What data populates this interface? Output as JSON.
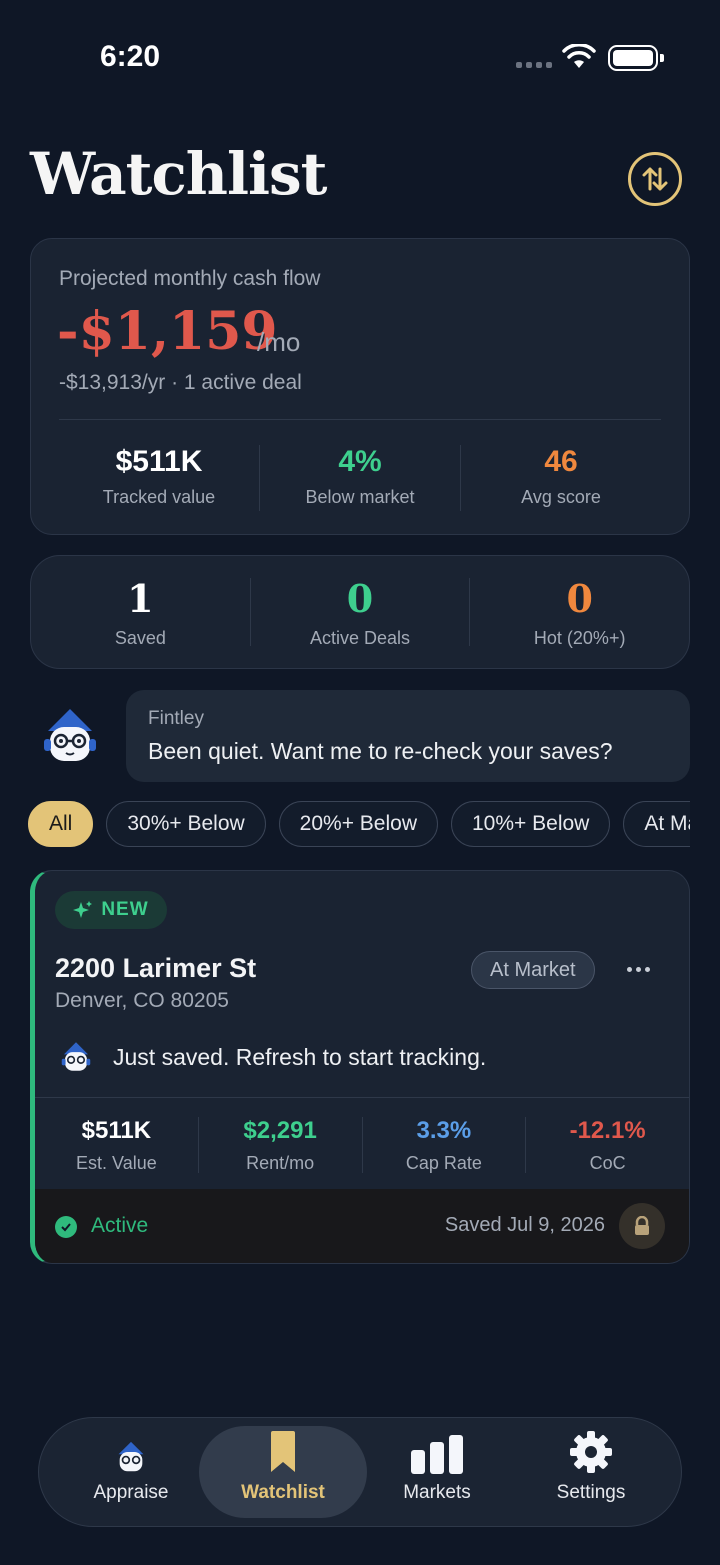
{
  "status_bar": {
    "time": "6:20"
  },
  "header": {
    "title": "Watchlist",
    "sort_icon": "sort-arrows-icon"
  },
  "cash_flow": {
    "label": "Projected monthly cash flow",
    "value": "-$1,159",
    "unit": "/mo",
    "sub": "-$13,913/yr · 1 active deal",
    "stats": [
      {
        "value": "$511K",
        "label": "Tracked value",
        "color": "#ffffff"
      },
      {
        "value": "4%",
        "label": "Below market",
        "color": "#3ecf8e"
      },
      {
        "value": "46",
        "label": "Avg score",
        "color": "#f0883e"
      }
    ]
  },
  "counts": [
    {
      "value": "1",
      "label": "Saved",
      "color": "#ffffff"
    },
    {
      "value": "0",
      "label": "Active Deals",
      "color": "#3ecf8e"
    },
    {
      "value": "0",
      "label": "Hot (20%+)",
      "color": "#f0883e"
    }
  ],
  "assistant": {
    "name": "Fintley",
    "message": "Been quiet. Want me to re-check your saves?"
  },
  "filters": [
    {
      "label": "All",
      "active": true
    },
    {
      "label": "30%+ Below",
      "active": false
    },
    {
      "label": "20%+ Below",
      "active": false
    },
    {
      "label": "10%+ Below",
      "active": false
    },
    {
      "label": "At Market",
      "active": false
    }
  ],
  "deal": {
    "badge": "NEW",
    "address": "2200 Larimer St",
    "city": "Denver, CO 80205",
    "market_status": "At Market",
    "note": "Just saved. Refresh to start tracking.",
    "stats": [
      {
        "value": "$511K",
        "label": "Est. Value",
        "color": "#ffffff"
      },
      {
        "value": "$2,291",
        "label": "Rent/mo",
        "color": "#3ecf8e"
      },
      {
        "value": "3.3%",
        "label": "Cap Rate",
        "color": "#5b9ee8"
      },
      {
        "value": "-12.1%",
        "label": "CoC",
        "color": "#e0584c"
      }
    ],
    "status": "Active",
    "saved": "Saved Jul 9, 2026"
  },
  "tabs": [
    {
      "label": "Appraise",
      "icon": "mascot-icon",
      "active": false
    },
    {
      "label": "Watchlist",
      "icon": "bookmark-icon",
      "active": true
    },
    {
      "label": "Markets",
      "icon": "bar-chart-icon",
      "active": false
    },
    {
      "label": "Settings",
      "icon": "gear-icon",
      "active": false
    }
  ],
  "colors": {
    "accent": "#e3c478",
    "positive": "#3ecf8e",
    "negative": "#e0584c",
    "warning": "#f0883e",
    "background": "#0f1726"
  }
}
